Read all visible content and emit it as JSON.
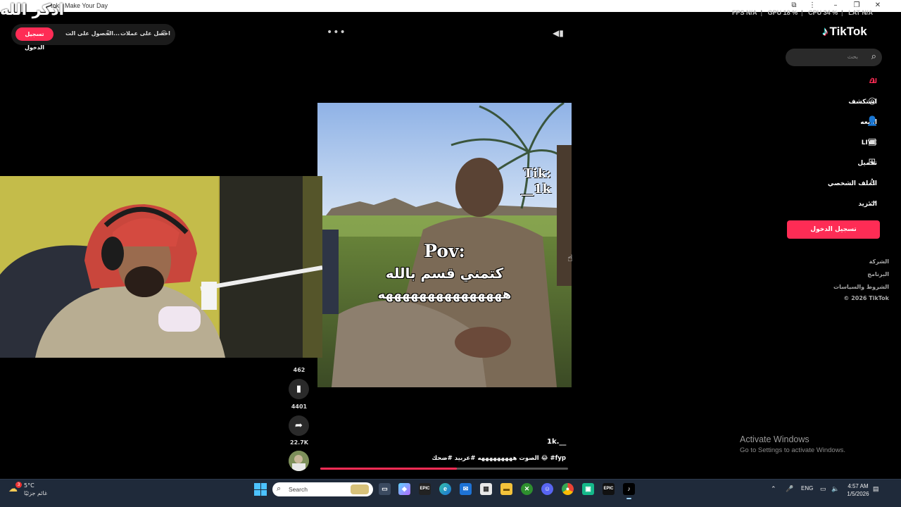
{
  "window": {
    "title": "tok - Make Your Day",
    "overlay_text": "اذكر الله"
  },
  "perf_overlay": {
    "fps": "FPS N/A",
    "gpu": "GPU 18 %",
    "cpu": "CPU 34 %",
    "lat": "LAT N/A"
  },
  "topbar": {
    "login_label": "تسجيل الدخول",
    "get_app_label": "الحصول على الت...",
    "get_coins_label": "احصل على عملات"
  },
  "sidebar": {
    "logo_text": "TikTok",
    "search_placeholder": "بحث",
    "items": [
      {
        "label": "لك",
        "icon": "home-icon"
      },
      {
        "label": "استكشف",
        "icon": "compass-icon"
      },
      {
        "label": "اتابعه",
        "icon": "following-icon"
      },
      {
        "label": "LIVE",
        "icon": "live-icon"
      },
      {
        "label": "تحميل",
        "icon": "upload-icon"
      },
      {
        "label": "الملف الشخصي",
        "icon": "profile-icon"
      },
      {
        "label": "المزيد",
        "icon": "more-icon"
      }
    ],
    "signup_label": "تسجيل الدخول",
    "footer_links": [
      "الشركة",
      "البرنامج",
      "الشروط والسياسات",
      "© 2026 TikTok"
    ]
  },
  "video": {
    "watermark": "Tik:\n__1k",
    "caption_line1": "Pov:",
    "caption_line2": "كتمني قسم بالله",
    "caption_line3": "هههههههههههههههه",
    "progress": 0.55
  },
  "actions": {
    "comments_count": "462",
    "saves_count": "4401",
    "shares_count": "22.7K"
  },
  "post": {
    "author": "1k.__",
    "description": "الصوت هههههههههه #عربيد #ضحك 😂 #fyp"
  },
  "activate_windows": {
    "line1": "Activate Windows",
    "line2": "Go to Settings to activate Windows."
  },
  "taskbar": {
    "weather_temp": "5°C",
    "weather_desc": "غائم جزئيًا",
    "weather_badge": "3",
    "search_placeholder": "Search",
    "language": "ENG",
    "time": "4:57 AM",
    "date": "1/5/2026"
  },
  "colors": {
    "accent": "#fe2c55",
    "background": "#000000",
    "taskbar": "#1f2a3a"
  }
}
